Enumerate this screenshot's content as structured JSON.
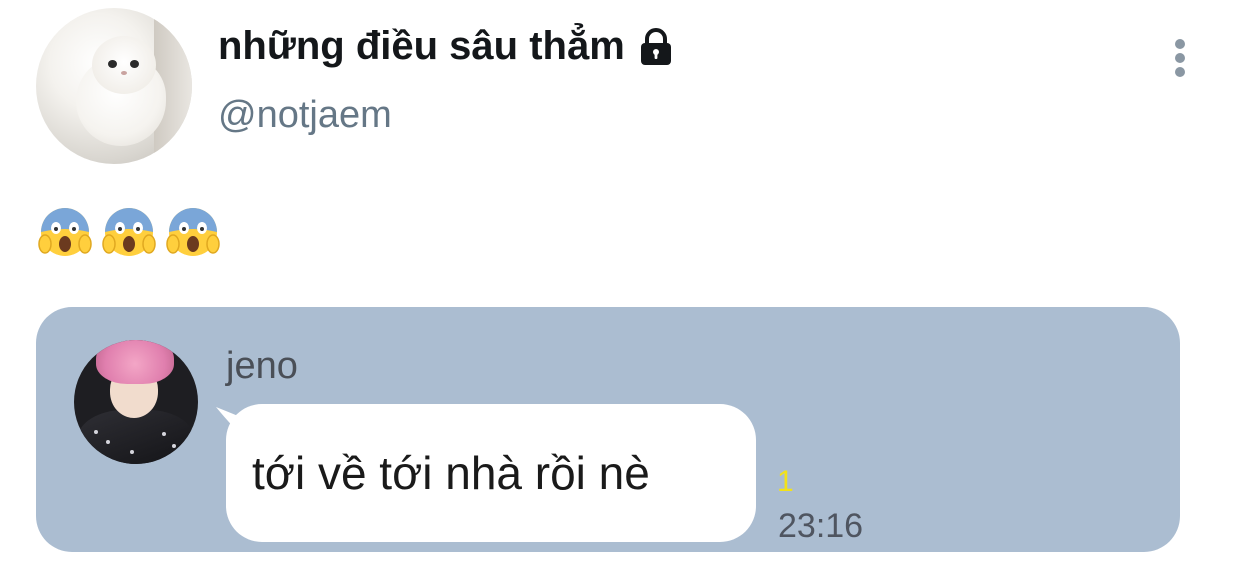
{
  "tweet": {
    "display_name": "những điều sâu thẳm",
    "handle": "@notjaem",
    "protected_icon": "lock-icon",
    "more_icon": "more-vertical-icon",
    "profile_avatar": "white-cat-avatar",
    "emojis": [
      "😱",
      "😱",
      "😱"
    ]
  },
  "chat": {
    "sender_avatar": "pink-hair-avatar",
    "sender_name": "jeno",
    "message": "tới về tới nhà rồi nè",
    "unread_count": "1",
    "timestamp": "23:16"
  },
  "colors": {
    "chat_background": "#abbdd1",
    "bubble": "#ffffff",
    "unread": "#f2e21a",
    "handle": "#657786",
    "name": "#14171a"
  }
}
